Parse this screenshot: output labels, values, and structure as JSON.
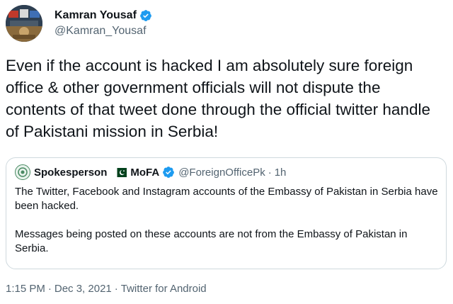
{
  "author": {
    "name": "Kamran Yousaf",
    "handle": "@Kamran_Yousaf",
    "verified": true
  },
  "tweet": {
    "text": "Even if the account is hacked I am absolutely sure foreign office & other government officials will not dispute the contents of that tweet done through the official twitter handle of Pakistani mission in Serbia!"
  },
  "quote": {
    "name": "Spokesperson",
    "name2": "MoFA",
    "handle": "@ForeignOfficePk",
    "separator": "·",
    "time": "1h",
    "paragraph1": "The Twitter, Facebook and Instagram accounts of the Embassy of Pakistan in Serbia have been hacked.",
    "paragraph2": "Messages being posted on these accounts are not from the Embassy of Pakistan in Serbia."
  },
  "meta": {
    "time": "1:15 PM",
    "date": "Dec 3, 2021",
    "source": "Twitter for Android",
    "separator": "·"
  },
  "colors": {
    "verified": "#1d9bf0",
    "secondary_text": "#536471",
    "border": "#cfd9de",
    "flag_green": "#01411c"
  }
}
